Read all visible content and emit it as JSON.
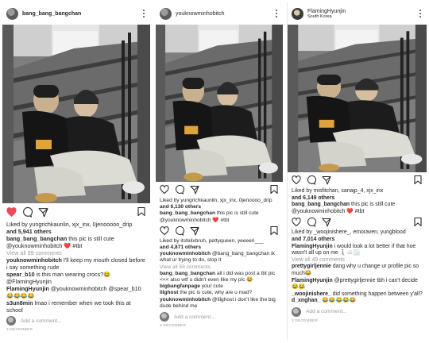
{
  "posts": [
    {
      "username": "bang_bang_bangchan",
      "location": "",
      "liked": true,
      "likes_line_1": "Liked by yungrichkaunlin, xjx_inx, 0jenooooo_drip",
      "likes_line_2": "and 5,941 others",
      "caption_user": "bang_bang_bangchan",
      "caption_text": " this pic is still cute @youknowminhobitch ❤️ #tbt",
      "view_all": "View all 99 comments",
      "comments": [
        {
          "user": "youknowminhobitch",
          "text": " I'll keep my mouth closed before i say something rude"
        },
        {
          "user": "spear_b10",
          "text": " is this man wearing crocs?😂 @FlamingHyunjin"
        },
        {
          "user": "FlamingHyunjin",
          "text": " @youknowminhobitch @spear_b10 😂😂😂😂"
        },
        {
          "user": "s3un8min",
          "text": " lmao i remember when we took this at school"
        }
      ],
      "add_comment": "Add a comment...",
      "date": "3 DECEMBER"
    },
    {
      "username": "youknowminhobitch",
      "location": "",
      "liked": false,
      "likes_line_1": "Liked by yungrichkaunlin, xjx_inx, 0jenoooo_drip",
      "likes_line_2": "and 6,130 others",
      "caption_user": "bang_bang_bangchan",
      "caption_text": " this pic is still cute @youknowminhobitch ❤️ #tbt",
      "second_likes_line_1": "Liked by itsfelixbruh, pettyqueen, yeeeeri___",
      "second_likes_line_2": "and 4,871 others",
      "second_caption_user": "youknowminhobitch",
      "second_caption_text": " @bang_bang_bangchan ik what ur trying to do, stop it",
      "view_all": "View all 59 comments",
      "comments": [
        {
          "user": "bang_bang_bangchan",
          "text": " all i did was post a tbt pic <<< also wtf u didn't even like my pic 😂"
        },
        {
          "user": "bigbangfanpage",
          "text": " your cute"
        },
        {
          "user": "lilghost",
          "text": " the pic is cute, why are u mad?"
        },
        {
          "user": "youknowminhobitch",
          "text": " @lilghost i don't like the big dude behind me"
        }
      ],
      "add_comment": "Add a comment...",
      "date": "3 DECEMBER"
    },
    {
      "username": "FlamingHyunjin",
      "location": "South Korea",
      "liked": false,
      "likes_line_1": "Liked by misfitchan, sanajp_4, xjx_inx",
      "likes_line_2": "and 6,149 others",
      "caption_user": "bang_bang_bangchan",
      "caption_text": " this pic is still cute @youknowminhobitch ❤️ #tbt",
      "second_likes_line_1": "Liked by _woojinishere_, emoraven, yungblood",
      "second_likes_line_2": "and 7,014 others",
      "second_caption_user": "FlamingHyunjin",
      "second_caption_text": " i would look a lot better if that hoe wasn't all up on me 🚶‍♂️☁️🌫️",
      "view_all": "View all 49 comments",
      "comments": [
        {
          "user": "prettygirljennie",
          "text": " dang why u change ur profile pic so much😂"
        },
        {
          "user": "FlamingHyunjin",
          "text": " @prettygirljennie tbh i can't decide😂😂"
        },
        {
          "user": "_woojinishere_",
          "text": " did something happen between y'all?"
        },
        {
          "user": "d_xnghan_",
          "text": " 😂😂😂😂😂"
        }
      ],
      "add_comment": "Add a comment...",
      "date": "3 DECEMBER"
    }
  ],
  "icons": [
    "more-options-icon",
    "heart-icon",
    "comment-icon",
    "share-icon",
    "bookmark-icon"
  ],
  "colors": {
    "like_red": "#ed4956",
    "muted": "#9a9a9a",
    "text": "#262626"
  }
}
